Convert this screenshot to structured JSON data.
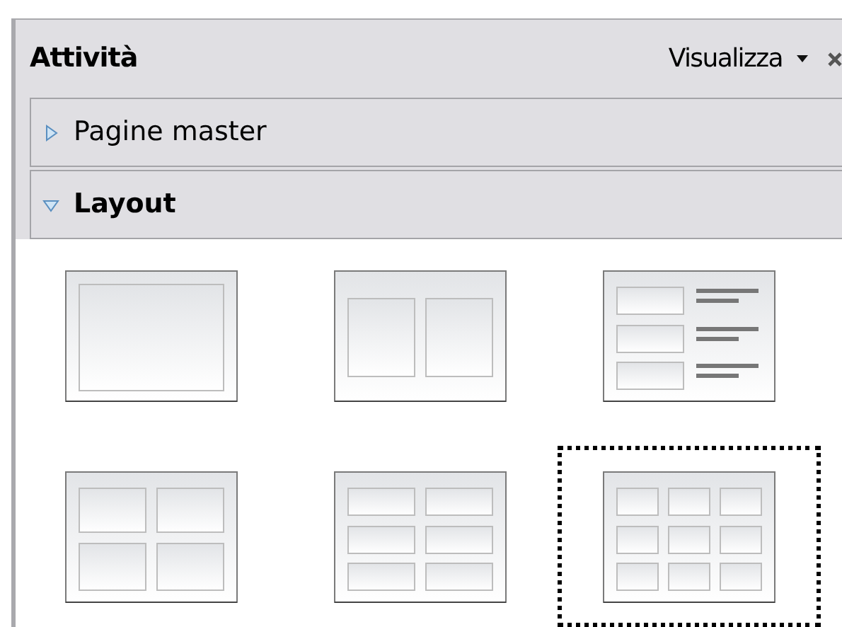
{
  "panel": {
    "title": "Attività",
    "view_menu": "Visualizza"
  },
  "sections": [
    {
      "label": "Pagine master",
      "expanded": false
    },
    {
      "label": "Layout",
      "expanded": true
    }
  ],
  "layouts": [
    {
      "kind": "blank",
      "selected": false
    },
    {
      "kind": "two_columns",
      "selected": false
    },
    {
      "kind": "text_list",
      "selected": false
    },
    {
      "kind": "grid_2x2",
      "selected": false
    },
    {
      "kind": "grid_2x3",
      "selected": false
    },
    {
      "kind": "grid_3x3",
      "selected": true
    }
  ]
}
